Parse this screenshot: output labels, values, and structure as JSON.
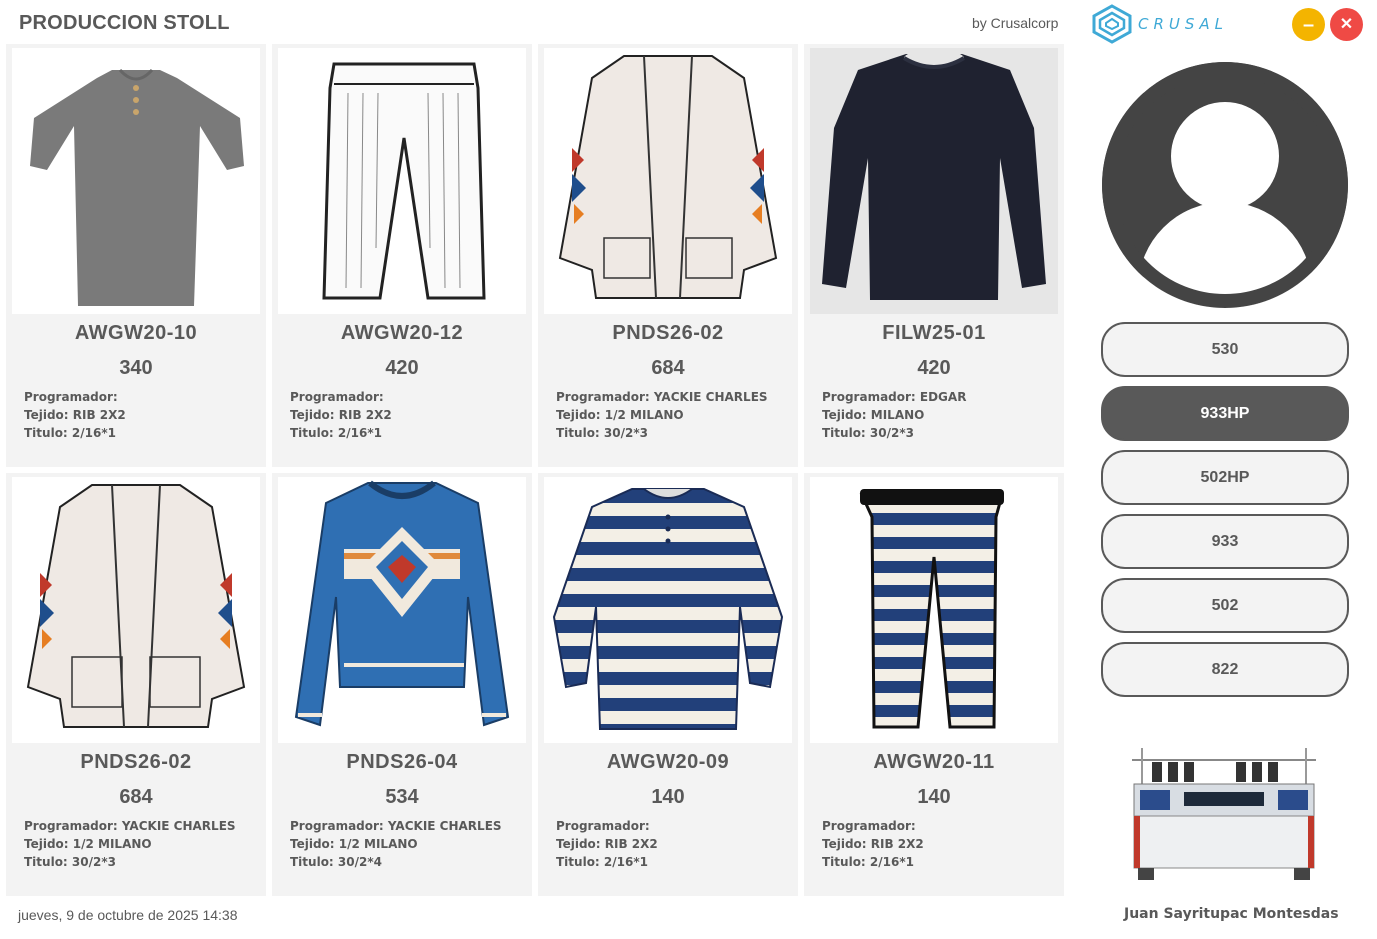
{
  "header": {
    "title": "PRODUCCION STOLL",
    "byline": "by Crusalcorp",
    "logo_text": "CRUSAL",
    "minimize_glyph": "–",
    "close_glyph": "✕"
  },
  "cards": [
    {
      "code": "AWGW20-10",
      "qty": "340",
      "programador": "Programador:",
      "tejido": "Tejido: RIB 2X2",
      "titulo": "Titulo: 2/16*1",
      "image": "gray-knit-dress-photo"
    },
    {
      "code": "AWGW20-12",
      "qty": "420",
      "programador": "Programador:",
      "tejido": "Tejido: RIB 2X2",
      "titulo": "Titulo: 2/16*1",
      "image": "white-knit-pants-sketch"
    },
    {
      "code": "PNDS26-02",
      "qty": "684",
      "programador": "Programador: YACKIE CHARLES",
      "tejido": "Tejido: 1/2 MILANO",
      "titulo": "Titulo: 30/2*3",
      "image": "cream-cardigan-sketch"
    },
    {
      "code": "FILW25-01",
      "qty": "420",
      "programador": "Programador: EDGAR",
      "tejido": "Tejido: MILANO",
      "titulo": "Titulo: 30/2*3",
      "image": "navy-sweater-photo"
    },
    {
      "code": "PNDS26-02",
      "qty": "684",
      "programador": "Programador: YACKIE CHARLES",
      "tejido": "Tejido: 1/2 MILANO",
      "titulo": "Titulo: 30/2*3",
      "image": "cream-cardigan-sketch"
    },
    {
      "code": "PNDS26-04",
      "qty": "534",
      "programador": "Programador: YACKIE CHARLES",
      "tejido": "Tejido: 1/2 MILANO",
      "titulo": "Titulo: 30/2*4",
      "image": "blue-pattern-sweater-sketch"
    },
    {
      "code": "AWGW20-09",
      "qty": "140",
      "programador": "Programador:",
      "tejido": "Tejido: RIB 2X2",
      "titulo": "Titulo: 2/16*1",
      "image": "striped-henley-sketch"
    },
    {
      "code": "AWGW20-11",
      "qty": "140",
      "programador": "Programador:",
      "tejido": "Tejido: RIB 2X2",
      "titulo": "Titulo: 2/16*1",
      "image": "striped-pants-sketch"
    }
  ],
  "machines": [
    {
      "label": "530",
      "active": false
    },
    {
      "label": "933HP",
      "active": true
    },
    {
      "label": "502HP",
      "active": false
    },
    {
      "label": "933",
      "active": false
    },
    {
      "label": "502",
      "active": false
    },
    {
      "label": "822",
      "active": false
    }
  ],
  "footer": {
    "datetime": "jueves, 9 de octubre de 2025  14:38",
    "user_name": "Juan Sayritupac Montesdas"
  },
  "colors": {
    "accent_active": "#595959",
    "card_bg": "#f3f3f3",
    "logo_blue": "#3fa9d6",
    "minimize": "#f4b400",
    "close": "#ef4a45"
  }
}
